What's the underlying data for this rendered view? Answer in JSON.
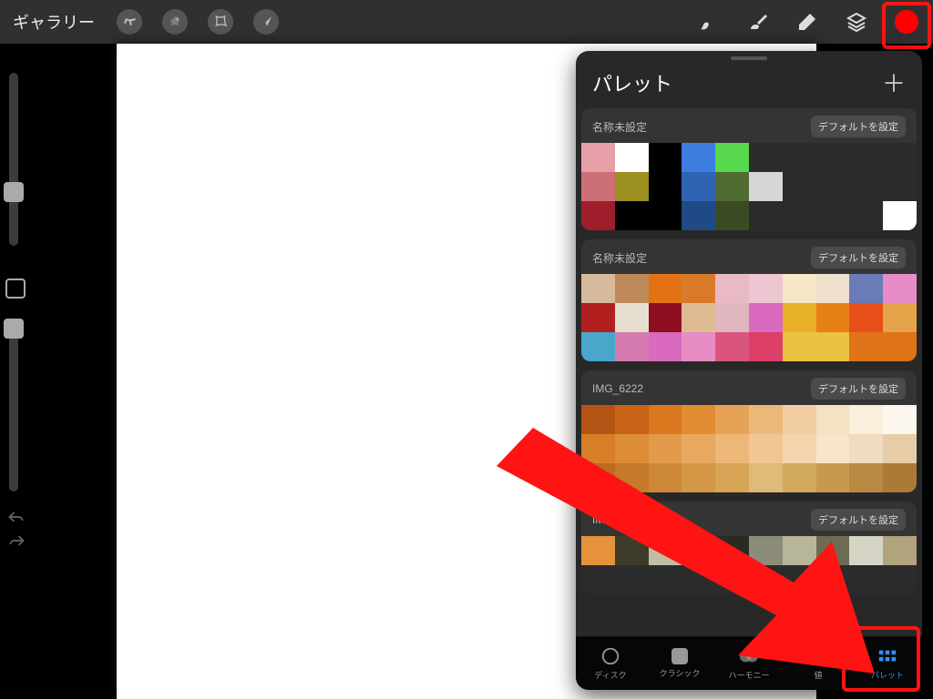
{
  "topbar": {
    "gallery": "ギャラリー"
  },
  "panel": {
    "title": "パレット",
    "add": "＋"
  },
  "palettes": [
    {
      "name": "名称未設定",
      "default_btn": "デフォルトを設定",
      "colors": [
        "#e79fa7",
        "#ffffff",
        "#000000",
        "#3e7de0",
        "#57d84d",
        "",
        "",
        "",
        "",
        "",
        "#cc6f77",
        "#9a8f1f",
        "#000000",
        "#2f64b3",
        "#4f6b32",
        "#d6d6d6",
        "",
        "",
        "",
        "",
        "#9e1f2b",
        "#000000",
        "#000000",
        "#1f4a86",
        "#3a4b23",
        "",
        "",
        "",
        "",
        "#ffffff"
      ]
    },
    {
      "name": "名称未設定",
      "default_btn": "デフォルトを設定",
      "colors": [
        "#d6ba9c",
        "#bf8a5a",
        "#e27214",
        "#d97a2a",
        "#e9b9c5",
        "#ecc6d0",
        "#f5e7c7",
        "#efe0cd",
        "#6a7bb8",
        "#e78cc5",
        "#b11f1f",
        "#e6dfd0",
        "#8f0f22",
        "#dfbb93",
        "#e0b6be",
        "#d96abf",
        "#e8b026",
        "#e77f17",
        "#e84f1a",
        "#e6a248",
        "#48a7cb",
        "#d57baf",
        "#d96abf",
        "#e78cc5",
        "#d9557d",
        "#dc3f67",
        "#eac23f",
        "#eac23f",
        "#e07217",
        "#e07217"
      ]
    },
    {
      "name": "IMG_6222",
      "default_btn": "デフォルトを設定",
      "colors": [
        "#b35415",
        "#c96318",
        "#da7820",
        "#e28c34",
        "#e6a357",
        "#ecb87a",
        "#f1cfa2",
        "#f5e2c3",
        "#f8efdd",
        "#fbf6ee",
        "#d77f28",
        "#dd8c37",
        "#e49a4b",
        "#e8a85f",
        "#edb778",
        "#f1c693",
        "#f4d5ae",
        "#f7e4ca",
        "#efdcc1",
        "#e6cda8",
        "#bb6c1f",
        "#c47a2a",
        "#cd8937",
        "#d39745",
        "#d8a456",
        "#debb78",
        "#d3a95d",
        "#c6994f",
        "#b88942",
        "#ab7a36"
      ]
    },
    {
      "name": "IMG_6",
      "default_btn": "デフォルトを設定",
      "colors": [
        "#e5923b",
        "#3f3b2a",
        "#bfbda4",
        "#78795e",
        "#2b2924",
        "#8c8c78",
        "#b7b59a",
        "#6e6b54",
        "#d6d5c5",
        "#b2a37f",
        "",
        "",
        "",
        "",
        "",
        "",
        "",
        "",
        "",
        ""
      ]
    }
  ],
  "tabs": {
    "disk": "ディスク",
    "classic": "クラシック",
    "harmony": "ハーモニー",
    "value": "値",
    "palette": "パレット"
  },
  "colors": {
    "active_color": "#ff0000"
  }
}
